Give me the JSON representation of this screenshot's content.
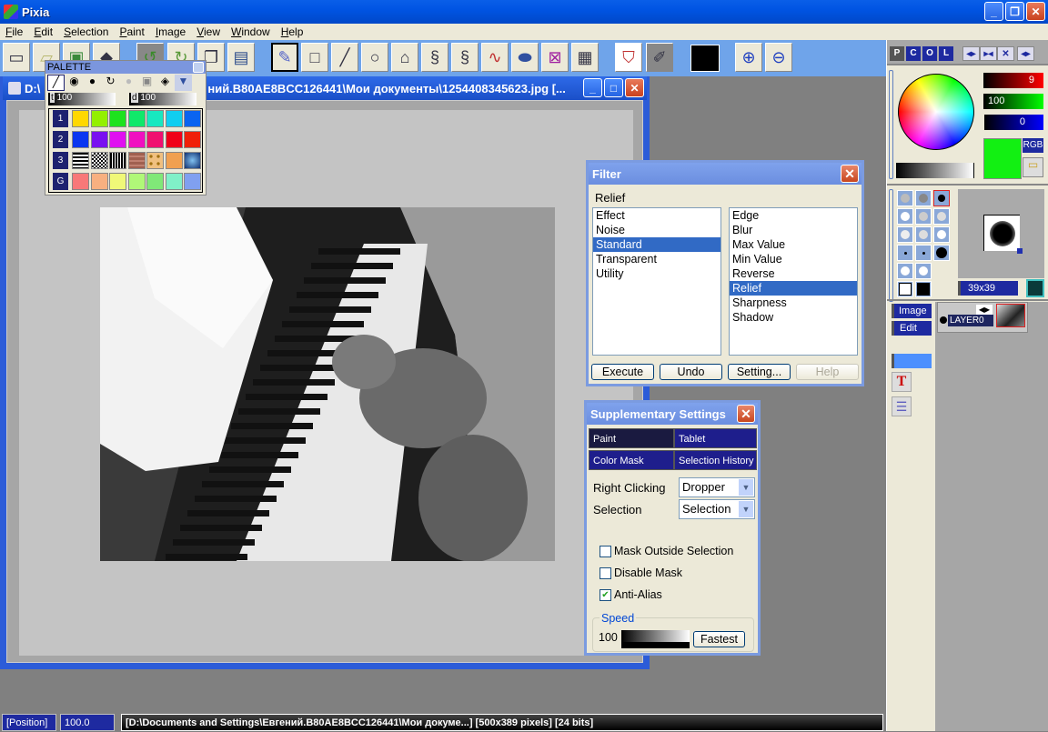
{
  "app": {
    "title": "Pixia"
  },
  "window_controls": {
    "minimize": "_",
    "restore": "❐",
    "close": "✕"
  },
  "menu": [
    "File",
    "Edit",
    "Selection",
    "Paint",
    "Image",
    "View",
    "Window",
    "Help"
  ],
  "toolbar": {
    "file_tools": [
      "new-icon",
      "open-icon",
      "save-icon",
      "ink-icon"
    ],
    "edit_tools": [
      "undo-icon",
      "redo-icon",
      "copy-icon",
      "paste-icon"
    ],
    "draw_tools": [
      "pen-icon",
      "rectangle-icon",
      "line-icon",
      "ellipse-icon",
      "polygon-icon",
      "lasso-icon",
      "lasso-pen-icon",
      "curve-icon",
      "fill-icon",
      "deselect-icon",
      "transparency-icon"
    ],
    "other_tools": [
      "bucket-icon",
      "ruler-icon"
    ],
    "current_color": "#000000",
    "zoom_in": "zoom-in-icon",
    "zoom_out": "zoom-out-icon"
  },
  "palette": {
    "title": "PALETTE",
    "tools": [
      "pencil-icon",
      "airbrush-icon",
      "brush-icon",
      "lasso-tool-icon",
      "blur-icon",
      "stamp-icon",
      "eraser-icon",
      "dropdown-icon"
    ],
    "t_label": "t",
    "t_value": "100",
    "d_label": "d",
    "d_value": "100",
    "rows": [
      {
        "label": "1",
        "colors": [
          "#ffd800",
          "#93f000",
          "#1de21d",
          "#10e86a",
          "#18e8c0",
          "#10cef0",
          "#0a64f0"
        ]
      },
      {
        "label": "2",
        "colors": [
          "#0a36f0",
          "#7a10f0",
          "#e010f0",
          "#f010c0",
          "#f01070",
          "#f00018",
          "#f02008"
        ]
      },
      {
        "label": "3",
        "colors": [
          "pattern-dashes",
          "pattern-checker",
          "pattern-grid",
          "pattern-brick",
          "pattern-paws",
          "#f0a050",
          "pattern-water"
        ]
      },
      {
        "label": "G",
        "colors": [
          "#f87878",
          "#f8b080",
          "#f0f878",
          "#b0f878",
          "#80e878",
          "#80f0c8",
          "#80a0f0"
        ]
      }
    ]
  },
  "document": {
    "title": "D:\\Documents and Settings\\Евгений.B80AE8BCC126441\\Мои документы\\1254408345623.jpg [...",
    "title_visible_prefix": "D:\\",
    "title_visible_suffix": "ний.B80AE8BCC126441\\Мои документы\\1254408345623.jpg [...",
    "image_desc": "Grayscale photo of a kitten on a piano keyboard with sheet music"
  },
  "filter_dialog": {
    "title": "Filter",
    "current": "Relief",
    "categories": [
      "Effect",
      "Noise",
      "Standard",
      "Transparent",
      "Utility"
    ],
    "selected_category": "Standard",
    "filters": [
      "Edge",
      "Blur",
      "Max Value",
      "Min Value",
      "Reverse",
      "Relief",
      "Sharpness",
      "Shadow"
    ],
    "selected_filter": "Relief",
    "buttons": {
      "execute": "Execute",
      "undo": "Undo",
      "setting": "Setting...",
      "help": "Help"
    }
  },
  "supp_dialog": {
    "title": "Supplementary Settings",
    "tabs": [
      "Paint",
      "Tablet",
      "Color Mask",
      "Selection History"
    ],
    "active_tab": "Paint",
    "right_click_label": "Right Clicking",
    "right_click_value": "Dropper",
    "selection_label": "Selection",
    "selection_value": "Selection",
    "checkboxes": [
      {
        "label": "Mask Outside Selection",
        "checked": false
      },
      {
        "label": "Disable Mask",
        "checked": false
      },
      {
        "label": "Anti-Alias",
        "checked": true
      }
    ],
    "speed_group": "Speed",
    "speed_value": "100",
    "fastest_button": "Fastest"
  },
  "right_panel": {
    "tabs": [
      "P",
      "C",
      "O",
      "L"
    ],
    "arrows": [
      "expand-icon",
      "collapse-icon",
      "close-x-icon",
      "swap-icon"
    ],
    "rgb": {
      "r": "9",
      "g": "100",
      "b": "0"
    },
    "current_color": "#12f012",
    "rgb_button": "RGB",
    "brush_size": "39x39",
    "layer_buttons": {
      "image": "Image",
      "edit": "Edit"
    },
    "layer_name": "LAYER0"
  },
  "status": {
    "position": "[Position]",
    "zoom": "100.0",
    "info": "[D:\\Documents and Settings\\Евгений.B80AE8BCC126441\\Мои докуме...] [500x389 pixels] [24 bits]"
  }
}
